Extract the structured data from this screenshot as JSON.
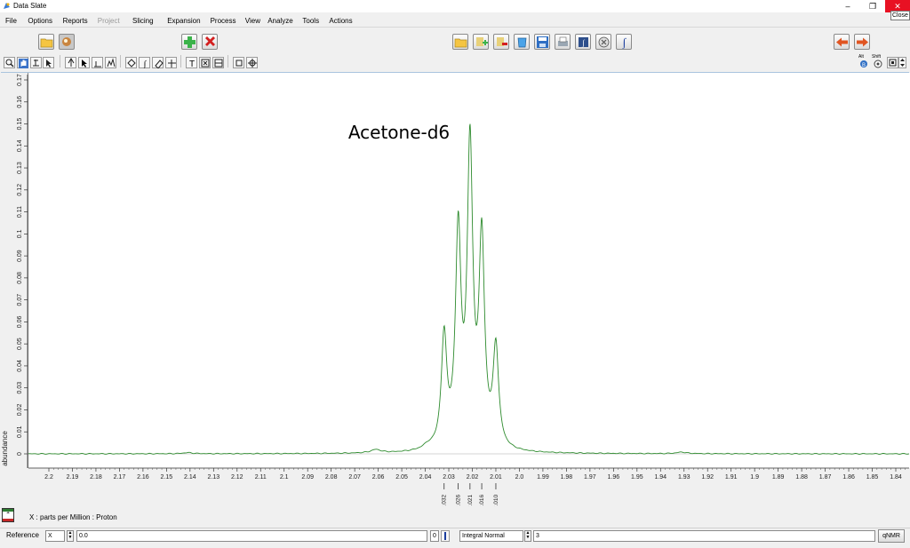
{
  "window": {
    "title": "Data Slate",
    "close_tooltip": "Close",
    "min_glyph": "–",
    "max_glyph": "❐",
    "close_glyph": "✕"
  },
  "menu": [
    "File",
    "Options",
    "Reports",
    "Project",
    "Slicing",
    "Expansion",
    "Process",
    "View",
    "Analyze",
    "Tools",
    "Actions"
  ],
  "menu_disabled": [
    "Project"
  ],
  "toolbar": {
    "shift_label": "Shift",
    "alt_label": "Alt"
  },
  "chart_data": {
    "type": "line",
    "title": "Acetone-d6",
    "ylabel": "abundance",
    "xlabel": "X : parts per Million : Proton",
    "xlim": [
      2.205,
      1.835
    ],
    "ylim": [
      -0.005,
      0.175
    ],
    "x_reversed": true,
    "color": "#2e8b2e",
    "x_ticks": [
      "2.2",
      "2.19",
      "2.18",
      "2.17",
      "2.16",
      "2.15",
      "2.14",
      "2.13",
      "2.12",
      "2.11",
      "2.1",
      "2.09",
      "2.08",
      "2.07",
      "2.06",
      "2.05",
      "2.04",
      "2.03",
      "2.02",
      "2.01",
      "2.0",
      "1.99",
      "1.98",
      "1.97",
      "1.96",
      "1.95",
      "1.94",
      "1.93",
      "1.92",
      "1.91",
      "1.9",
      "1.89",
      "1.88",
      "1.87",
      "1.86",
      "1.85",
      "1.84"
    ],
    "y_ticks": [
      "0",
      "0.01",
      "0.02",
      "0.03",
      "0.04",
      "0.05",
      "0.06",
      "0.07",
      "0.08",
      "0.09",
      "0.1",
      "0.11",
      "0.12",
      "0.13",
      "0.14",
      "0.15",
      "0.16",
      "0.17"
    ],
    "peaks": [
      {
        "x": 2.032,
        "height": 0.05,
        "label": "2.032"
      },
      {
        "x": 2.026,
        "height": 0.096,
        "label": "2.026"
      },
      {
        "x": 2.021,
        "height": 0.135,
        "label": "2.021"
      },
      {
        "x": 2.016,
        "height": 0.093,
        "label": "2.016"
      },
      {
        "x": 2.01,
        "height": 0.045,
        "label": "2.010"
      }
    ],
    "minor_peaks": [
      {
        "x": 2.061,
        "height": 0.0015
      },
      {
        "x": 2.039,
        "height": 0.0015
      },
      {
        "x": 2.141,
        "height": 0.0005
      },
      {
        "x": 1.931,
        "height": 0.0007
      }
    ]
  },
  "status": {
    "layer_number": "1",
    "units": "X : parts per Million : Proton"
  },
  "bottom": {
    "reference_label": "Reference",
    "axis_value": "X",
    "ref_value": "0.0",
    "zero_btn": "0",
    "integral_mode": "Integral Normal",
    "integral_value": "3",
    "qnmr_label": "qNMR"
  }
}
